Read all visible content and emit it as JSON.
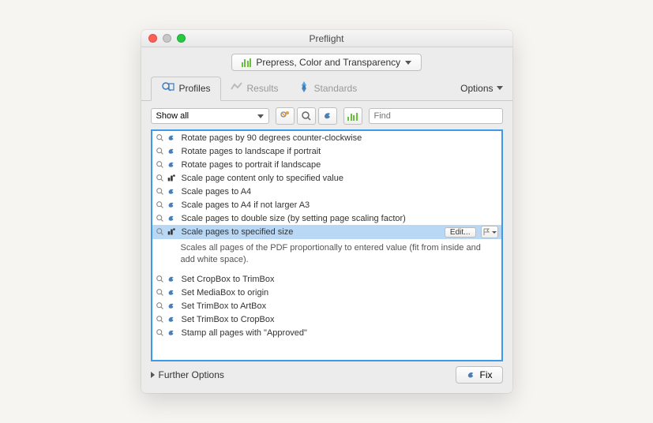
{
  "window": {
    "title": "Preflight"
  },
  "category": {
    "label": "Prepress, Color and Transparency"
  },
  "tabs": {
    "profiles": "Profiles",
    "results": "Results",
    "standards": "Standards",
    "options": "Options"
  },
  "toolbar": {
    "filter": "Show all",
    "find_placeholder": "Find"
  },
  "list": {
    "items": [
      {
        "label": "Rotate pages by 90 degrees counter-clockwise",
        "selected": false
      },
      {
        "label": "Rotate pages to landscape if portrait",
        "selected": false
      },
      {
        "label": "Rotate pages to portrait if landscape",
        "selected": false
      },
      {
        "label": "Scale page content only to specified value",
        "selected": false,
        "alt_icon": true
      },
      {
        "label": "Scale pages to A4",
        "selected": false
      },
      {
        "label": "Scale pages to A4 if not larger A3",
        "selected": false
      },
      {
        "label": "Scale pages to double size (by setting page scaling factor)",
        "selected": false
      },
      {
        "label": "Scale pages to specified size",
        "selected": true,
        "alt_icon": true,
        "edit_label": "Edit...",
        "description": "Scales all pages of the PDF proportionally to entered value (fit from inside and add white space)."
      },
      {
        "label": "Set CropBox to TrimBox",
        "selected": false
      },
      {
        "label": "Set MediaBox to origin",
        "selected": false
      },
      {
        "label": "Set TrimBox to ArtBox",
        "selected": false
      },
      {
        "label": "Set TrimBox to CropBox",
        "selected": false
      },
      {
        "label": "Stamp all pages with \"Approved\"",
        "selected": false
      }
    ]
  },
  "footer": {
    "further": "Further Options",
    "fix": "Fix"
  }
}
